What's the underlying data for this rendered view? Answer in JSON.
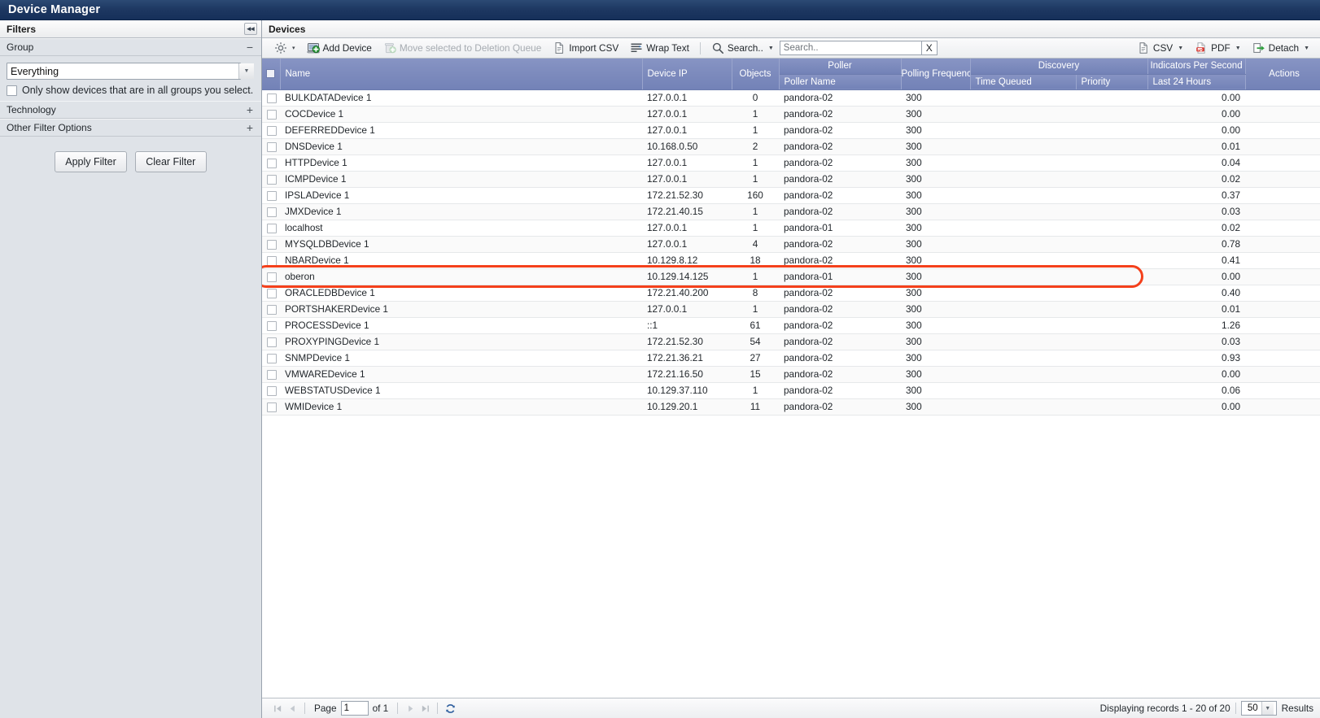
{
  "window": {
    "title": "Device Manager"
  },
  "sidebar": {
    "header": "Filters",
    "collapse_icon": "collapse-left-icon",
    "sections": [
      {
        "label": "Group",
        "state": "expanded",
        "toggle": "−"
      },
      {
        "label": "Technology",
        "state": "collapsed",
        "toggle": "+"
      },
      {
        "label": "Other Filter Options",
        "state": "collapsed",
        "toggle": "+"
      }
    ],
    "group": {
      "select_value": "Everything",
      "checkbox_label": "Only show devices that are in all groups you select.",
      "checkbox_checked": false
    },
    "buttons": {
      "apply": "Apply Filter",
      "clear": "Clear Filter"
    }
  },
  "main": {
    "header": "Devices",
    "toolbar": {
      "gear": {
        "name": "gear-icon",
        "caret": "▾"
      },
      "add_device": "Add Device",
      "move_to_deletion": "Move selected to Deletion Queue",
      "import_csv": "Import CSV",
      "wrap_text": "Wrap Text",
      "search_menu": "Search..",
      "search_placeholder": "Search..",
      "search_value": "",
      "clear_search": "X",
      "csv": "CSV",
      "pdf": "PDF",
      "detach": "Detach"
    },
    "table": {
      "group_headers": {
        "poller": "Poller",
        "discovery": "Discovery",
        "indicators": "Indicators Per Second"
      },
      "columns": [
        "Name",
        "Device IP",
        "Objects",
        "Poller Name",
        "Polling Frequency",
        "Time Queued",
        "Priority",
        "Last 24 Hours",
        "Actions"
      ],
      "highlighted_row_name": "oberon",
      "highlight_color": "#f4401b",
      "rows": [
        {
          "name": "BULKDATADevice 1",
          "ip": "127.0.0.1",
          "objects": "0",
          "poller": "pandora-02",
          "freq": "300",
          "queued": "",
          "priority": "",
          "last24": "0.00",
          "actions": ""
        },
        {
          "name": "COCDevice 1",
          "ip": "127.0.0.1",
          "objects": "1",
          "poller": "pandora-02",
          "freq": "300",
          "queued": "",
          "priority": "",
          "last24": "0.00",
          "actions": ""
        },
        {
          "name": "DEFERREDDevice 1",
          "ip": "127.0.0.1",
          "objects": "1",
          "poller": "pandora-02",
          "freq": "300",
          "queued": "",
          "priority": "",
          "last24": "0.00",
          "actions": ""
        },
        {
          "name": "DNSDevice 1",
          "ip": "10.168.0.50",
          "objects": "2",
          "poller": "pandora-02",
          "freq": "300",
          "queued": "",
          "priority": "",
          "last24": "0.01",
          "actions": ""
        },
        {
          "name": "HTTPDevice 1",
          "ip": "127.0.0.1",
          "objects": "1",
          "poller": "pandora-02",
          "freq": "300",
          "queued": "",
          "priority": "",
          "last24": "0.04",
          "actions": ""
        },
        {
          "name": "ICMPDevice 1",
          "ip": "127.0.0.1",
          "objects": "1",
          "poller": "pandora-02",
          "freq": "300",
          "queued": "",
          "priority": "",
          "last24": "0.02",
          "actions": ""
        },
        {
          "name": "IPSLADevice 1",
          "ip": "172.21.52.30",
          "objects": "160",
          "poller": "pandora-02",
          "freq": "300",
          "queued": "",
          "priority": "",
          "last24": "0.37",
          "actions": ""
        },
        {
          "name": "JMXDevice 1",
          "ip": "172.21.40.15",
          "objects": "1",
          "poller": "pandora-02",
          "freq": "300",
          "queued": "",
          "priority": "",
          "last24": "0.03",
          "actions": ""
        },
        {
          "name": "localhost",
          "ip": "127.0.0.1",
          "objects": "1",
          "poller": "pandora-01",
          "freq": "300",
          "queued": "",
          "priority": "",
          "last24": "0.02",
          "actions": ""
        },
        {
          "name": "MYSQLDBDevice 1",
          "ip": "127.0.0.1",
          "objects": "4",
          "poller": "pandora-02",
          "freq": "300",
          "queued": "",
          "priority": "",
          "last24": "0.78",
          "actions": ""
        },
        {
          "name": "NBARDevice 1",
          "ip": "10.129.8.12",
          "objects": "18",
          "poller": "pandora-02",
          "freq": "300",
          "queued": "",
          "priority": "",
          "last24": "0.41",
          "actions": ""
        },
        {
          "name": "oberon",
          "ip": "10.129.14.125",
          "objects": "1",
          "poller": "pandora-01",
          "freq": "300",
          "queued": "",
          "priority": "",
          "last24": "0.00",
          "actions": ""
        },
        {
          "name": "ORACLEDBDevice 1",
          "ip": "172.21.40.200",
          "objects": "8",
          "poller": "pandora-02",
          "freq": "300",
          "queued": "",
          "priority": "",
          "last24": "0.40",
          "actions": ""
        },
        {
          "name": "PORTSHAKERDevice 1",
          "ip": "127.0.0.1",
          "objects": "1",
          "poller": "pandora-02",
          "freq": "300",
          "queued": "",
          "priority": "",
          "last24": "0.01",
          "actions": ""
        },
        {
          "name": "PROCESSDevice 1",
          "ip": "::1",
          "objects": "61",
          "poller": "pandora-02",
          "freq": "300",
          "queued": "",
          "priority": "",
          "last24": "1.26",
          "actions": ""
        },
        {
          "name": "PROXYPINGDevice 1",
          "ip": "172.21.52.30",
          "objects": "54",
          "poller": "pandora-02",
          "freq": "300",
          "queued": "",
          "priority": "",
          "last24": "0.03",
          "actions": ""
        },
        {
          "name": "SNMPDevice 1",
          "ip": "172.21.36.21",
          "objects": "27",
          "poller": "pandora-02",
          "freq": "300",
          "queued": "",
          "priority": "",
          "last24": "0.93",
          "actions": ""
        },
        {
          "name": "VMWAREDevice 1",
          "ip": "172.21.16.50",
          "objects": "15",
          "poller": "pandora-02",
          "freq": "300",
          "queued": "",
          "priority": "",
          "last24": "0.00",
          "actions": ""
        },
        {
          "name": "WEBSTATUSDevice 1",
          "ip": "10.129.37.110",
          "objects": "1",
          "poller": "pandora-02",
          "freq": "300",
          "queued": "",
          "priority": "",
          "last24": "0.06",
          "actions": ""
        },
        {
          "name": "WMIDevice 1",
          "ip": "10.129.20.1",
          "objects": "11",
          "poller": "pandora-02",
          "freq": "300",
          "queued": "",
          "priority": "",
          "last24": "0.00",
          "actions": ""
        }
      ]
    },
    "footer": {
      "first": "⏮",
      "prev": "◀",
      "page_label": "Page",
      "page_value": "1",
      "of_label": "of 1",
      "next": "▶",
      "last": "⏭",
      "refresh_icon": "refresh-icon",
      "records_text": "Displaying records 1 - 20 of 20",
      "results_value": "50",
      "results_label": "Results"
    }
  }
}
